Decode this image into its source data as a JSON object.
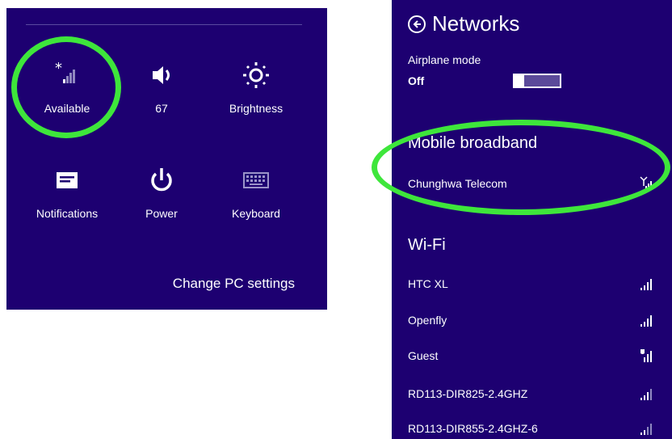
{
  "quick_settings": {
    "tiles": [
      {
        "label": "Available",
        "icon": "signal-available-icon"
      },
      {
        "label": "67",
        "icon": "volume-icon"
      },
      {
        "label": "Brightness",
        "icon": "brightness-icon"
      },
      {
        "label": "Notifications",
        "icon": "notifications-icon"
      },
      {
        "label": "Power",
        "icon": "power-icon"
      },
      {
        "label": "Keyboard",
        "icon": "keyboard-icon"
      }
    ],
    "change_pc_settings": "Change PC settings"
  },
  "networks": {
    "title": "Networks",
    "airplane_mode_label": "Airplane mode",
    "airplane_mode_state": "Off",
    "mobile_broadband": {
      "heading": "Mobile broadband",
      "items": [
        {
          "name": "Chunghwa Telecom"
        }
      ]
    },
    "wifi": {
      "heading": "Wi-Fi",
      "items": [
        {
          "name": "HTC XL"
        },
        {
          "name": "Openfly"
        },
        {
          "name": "Guest"
        },
        {
          "name": "RD113-DIR825-2.4GHZ"
        },
        {
          "name": "RD113-DIR855-2.4GHZ-6"
        }
      ]
    }
  },
  "colors": {
    "panel_bg": "#1d0071",
    "highlight_ring": "#3ee63b",
    "text": "#ffffff"
  }
}
